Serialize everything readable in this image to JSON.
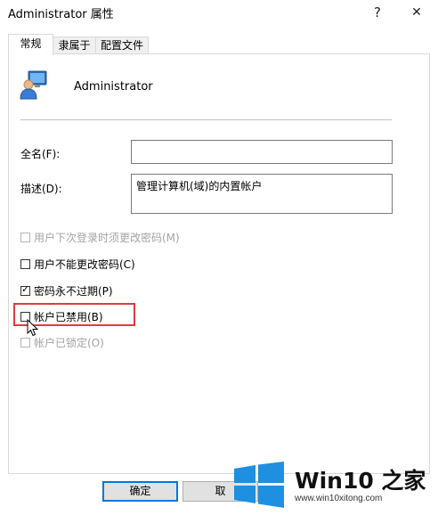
{
  "window": {
    "title": "Administrator 属性",
    "help_glyph": "?",
    "close_glyph": "✕"
  },
  "tabs": [
    {
      "label": "常规",
      "active": true
    },
    {
      "label": "隶属于",
      "active": false
    },
    {
      "label": "配置文件",
      "active": false
    }
  ],
  "user": {
    "name": "Administrator",
    "icon": "user-account-icon"
  },
  "fields": {
    "fullname_label": "全名(F):",
    "fullname_value": "",
    "description_label": "描述(D):",
    "description_value": "管理计算机(域)的内置帐户"
  },
  "checkboxes": [
    {
      "label": "用户下次登录时须更改密码(M)",
      "checked": false,
      "enabled": false
    },
    {
      "label": "用户不能更改密码(C)",
      "checked": false,
      "enabled": true
    },
    {
      "label": "密码永不过期(P)",
      "checked": true,
      "enabled": true
    },
    {
      "label": "帐户已禁用(B)",
      "checked": false,
      "enabled": true,
      "highlighted": true
    },
    {
      "label": "帐户已锁定(O)",
      "checked": false,
      "enabled": false
    }
  ],
  "buttons": {
    "ok": "确定",
    "cancel": "取"
  },
  "watermark": {
    "brand": "Win10 之家",
    "url": "www.win10xitong.com",
    "colors": {
      "logo_blue": "#1f8fe0"
    }
  },
  "colors": {
    "highlight": "#e03c3c",
    "default_button_border": "#0078d7"
  }
}
